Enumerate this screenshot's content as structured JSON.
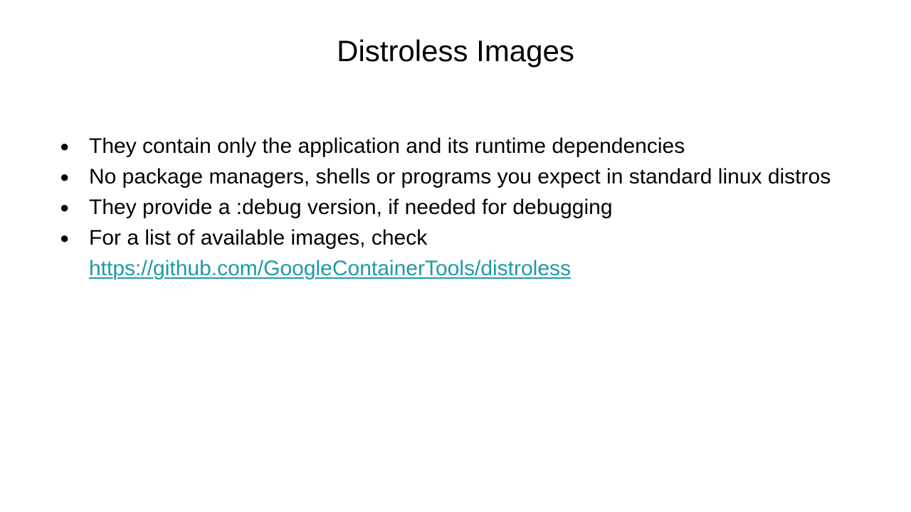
{
  "slide": {
    "title": "Distroless Images",
    "bullet_glyph": "●",
    "bullets": [
      {
        "text": "They contain only the application and its runtime dependencies"
      },
      {
        "text": "No package managers, shells or programs you expect in standard linux distros"
      },
      {
        "text": "They provide a :debug version, if needed for debugging"
      },
      {
        "text": "For a list of available images, check",
        "link": "https://github.com/GoogleContainerTools/distroless"
      }
    ],
    "colors": {
      "background": "#ffffff",
      "text": "#000000",
      "link": "#1a9ba8"
    }
  }
}
